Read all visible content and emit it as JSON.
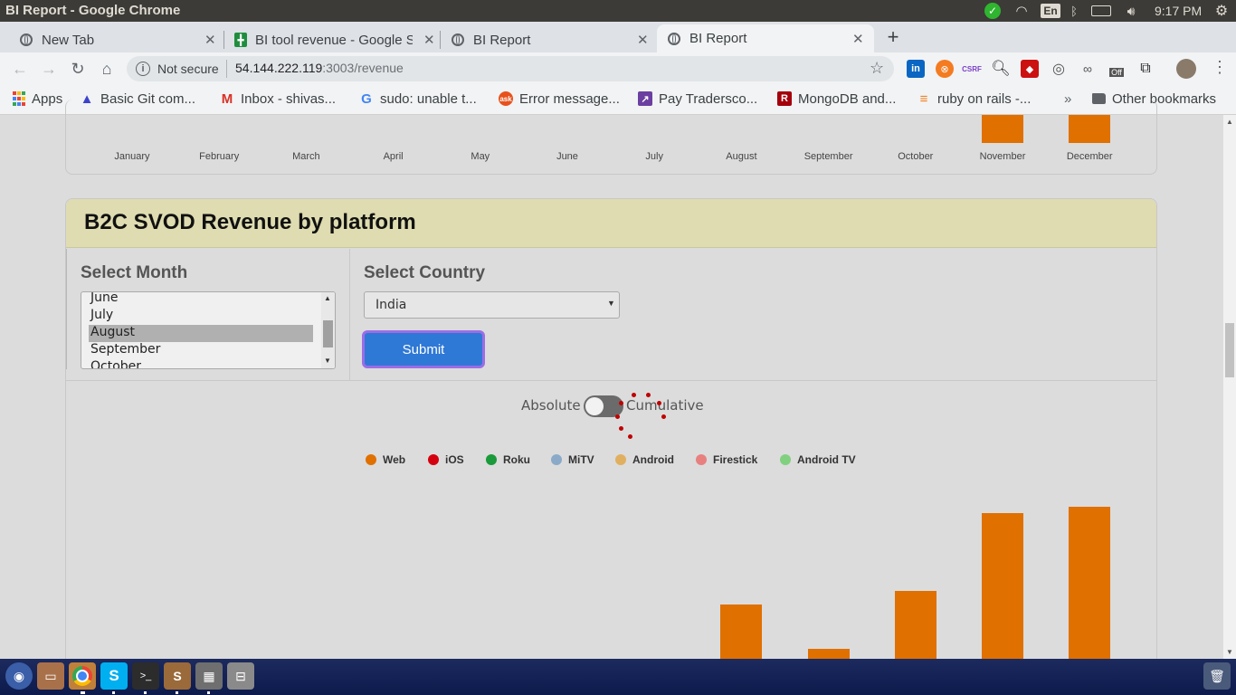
{
  "os": {
    "window_title": "BI Report - Google Chrome",
    "keyboard_layout": "En",
    "clock": "9:17 PM"
  },
  "tabs": [
    {
      "label": "New Tab"
    },
    {
      "label": "BI tool revenue - Google Sheets"
    },
    {
      "label": "BI Report"
    },
    {
      "label": "BI Report"
    }
  ],
  "toolbar": {
    "security_label": "Not secure",
    "url_host": "54.144.222.119",
    "url_rest": ":3003/revenue",
    "ext_off_badge": "Off",
    "ext_csrf": "CSRF"
  },
  "bookmarks": [
    {
      "label": "Apps",
      "icon": "apps-grid-icon"
    },
    {
      "label": "Basic Git com...",
      "icon": "atlassian-icon",
      "color": "#3d43c9"
    },
    {
      "label": "Inbox - shivas...",
      "icon": "gmail-icon",
      "color": "#d93025"
    },
    {
      "label": "sudo: unable t...",
      "icon": "google-icon",
      "color": "#4285f4"
    },
    {
      "label": "Error message...",
      "icon": "ask-icon",
      "color": "#e8511b"
    },
    {
      "label": "Pay Tradersco...",
      "icon": "traderscockpit-icon",
      "color": "#6b3fa0"
    },
    {
      "label": "MongoDB and...",
      "icon": "r-icon",
      "color": "#a3000c"
    },
    {
      "label": "ruby on rails -...",
      "icon": "stackoverflow-icon",
      "color": "#f48024"
    }
  ],
  "bookmarks_more": "»",
  "other_bookmarks": "Other bookmarks",
  "top_chart": {
    "months": [
      "January",
      "February",
      "March",
      "April",
      "May",
      "June",
      "July",
      "August",
      "September",
      "October",
      "November",
      "December"
    ]
  },
  "card": {
    "title": "B2C SVOD Revenue by platform",
    "select_month_heading": "Select Month",
    "select_country_heading": "Select Country",
    "month_options": [
      "June",
      "July",
      "August",
      "September",
      "October"
    ],
    "selected_month": "August",
    "country_value": "India",
    "submit_label": "Submit",
    "toggle_left": "Absolute",
    "toggle_right": "Cumulative",
    "toggle_state": "Absolute"
  },
  "colors": {
    "bar": "#e07000",
    "header_bg": "#dedcb0",
    "submit_bg": "#2e78d6"
  },
  "chart_data": {
    "type": "bar",
    "categories": [
      "January",
      "February",
      "March",
      "April",
      "May",
      "June",
      "July",
      "August",
      "September",
      "October",
      "November",
      "December"
    ],
    "legend": [
      {
        "name": "Web",
        "color": "#e07000"
      },
      {
        "name": "iOS",
        "color": "#d40010"
      },
      {
        "name": "Roku",
        "color": "#1a9a3a"
      },
      {
        "name": "MiTV",
        "color": "#8aaac8"
      },
      {
        "name": "Android",
        "color": "#e0b060"
      },
      {
        "name": "Firestick",
        "color": "#e88080"
      },
      {
        "name": "Android TV",
        "color": "#80d080"
      }
    ],
    "series": [
      {
        "name": "Web",
        "values": [
          0,
          0,
          0,
          0,
          0,
          0,
          26,
          82,
          41,
          94,
          166,
          172
        ]
      }
    ]
  },
  "taskbar": [
    "dash-icon",
    "files-icon",
    "chrome-icon",
    "skype-icon",
    "terminal-icon",
    "sublime-icon",
    "calculator-icon",
    "drive-icon",
    "trash-icon"
  ]
}
